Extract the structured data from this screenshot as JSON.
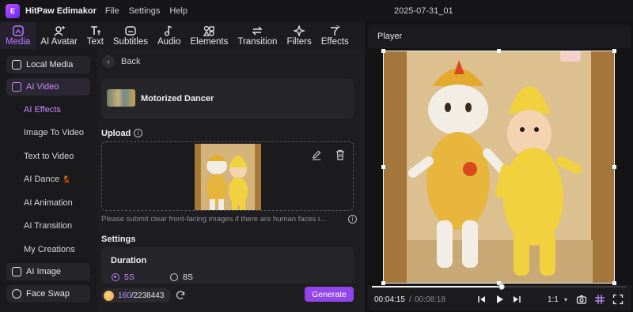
{
  "app": {
    "name": "HitPaw Edimakor",
    "logo_letter": "E",
    "menu": [
      "File",
      "Settings",
      "Help"
    ],
    "document_title": "2025-07-31_01"
  },
  "toolbar": {
    "items": [
      {
        "label": "Media",
        "icon": "media-icon",
        "active": true
      },
      {
        "label": "AI Avatar",
        "icon": "ai-avatar-icon"
      },
      {
        "label": "Text",
        "icon": "text-icon"
      },
      {
        "label": "Subtitles",
        "icon": "subtitles-icon"
      },
      {
        "label": "Audio",
        "icon": "audio-icon"
      },
      {
        "label": "Elements",
        "icon": "elements-icon"
      },
      {
        "label": "Transition",
        "icon": "transition-icon"
      },
      {
        "label": "Filters",
        "icon": "filters-icon"
      },
      {
        "label": "Effects",
        "icon": "effects-icon"
      }
    ]
  },
  "sidebar": {
    "local_media": "Local Media",
    "ai_video": "AI Video",
    "sub_items": [
      "AI Effects",
      "Image To Video",
      "Text to Video",
      "AI Dance",
      "AI Animation",
      "AI Transition",
      "My Creations"
    ],
    "ai_dance_badge": "💃",
    "ai_image": "AI Image",
    "face_swap": "Face Swap"
  },
  "panel": {
    "back_label": "Back",
    "effect_name": "Motorized Dancer",
    "upload_label": "Upload",
    "hint": "Please submit clear front-facing images if there are human faces i...",
    "settings_label": "Settings",
    "duration_label": "Duration",
    "duration_options": [
      "5S",
      "8S"
    ],
    "duration_selected": "5S",
    "credits_used": "160",
    "credits_total": "/2238443",
    "generate_label": "Generate"
  },
  "player": {
    "title": "Player",
    "time_current": "00:04:15",
    "time_separator": "/",
    "time_total": "00:08:18",
    "progress_fraction": 0.51,
    "ratio": "1:1",
    "ratio_caret": "▾"
  },
  "colors": {
    "accent": "#9245ea",
    "accent_text": "#c48cff"
  }
}
